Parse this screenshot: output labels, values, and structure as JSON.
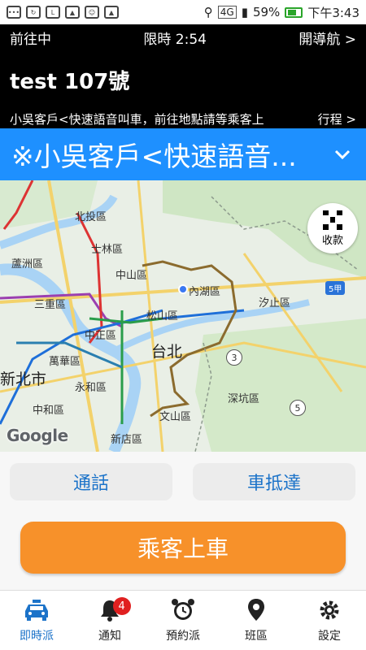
{
  "status_bar": {
    "network": "4G",
    "battery": "59%",
    "time": "下午3:43",
    "notif_icons": [
      "messenger-icon",
      "sync-icon",
      "line-icon",
      "image-icon",
      "avatar-icon",
      "app-icon"
    ]
  },
  "header": {
    "status": "前往中",
    "timer": "限時 2:54",
    "navigate": "開導航 >",
    "title": "test 107號",
    "message": "小吳客戶<快速語音叫車，前往地點請等乘客上",
    "trip": "行程 >"
  },
  "banner": {
    "text": "※小吳客戶<快速語音..."
  },
  "map": {
    "qr_label": "收款",
    "google": "Google",
    "labels": [
      {
        "text": "北投區"
      },
      {
        "text": "士林區"
      },
      {
        "text": "蘆洲區"
      },
      {
        "text": "中山區"
      },
      {
        "text": "內湖區"
      },
      {
        "text": "汐止區"
      },
      {
        "text": "三重區"
      },
      {
        "text": "松山區"
      },
      {
        "text": "中正區"
      },
      {
        "text": "萬華區"
      },
      {
        "text": "永和區"
      },
      {
        "text": "中和區"
      },
      {
        "text": "新店區"
      },
      {
        "text": "文山區"
      },
      {
        "text": "深坑區"
      }
    ],
    "cities": [
      "台北",
      "新北市"
    ],
    "shields": [
      "3",
      "5"
    ],
    "route_tag": "5甲",
    "colors": {
      "water": "#a9d3f5",
      "park": "#c9e4c0",
      "road": "#f3d26b",
      "district": "#8b6b2e"
    }
  },
  "actions": {
    "call": "通話",
    "arrive": "車抵達",
    "board": "乘客上車",
    "accent": "#f7912a",
    "link_color": "#1c73c9"
  },
  "nav": {
    "items": [
      {
        "label": "即時派",
        "icon": "taxi-icon"
      },
      {
        "label": "通知",
        "icon": "bell-icon",
        "badge": "4"
      },
      {
        "label": "預約派",
        "icon": "alarm-clock-icon"
      },
      {
        "label": "班區",
        "icon": "location-pin-icon"
      },
      {
        "label": "設定",
        "icon": "gear-icon"
      }
    ]
  }
}
